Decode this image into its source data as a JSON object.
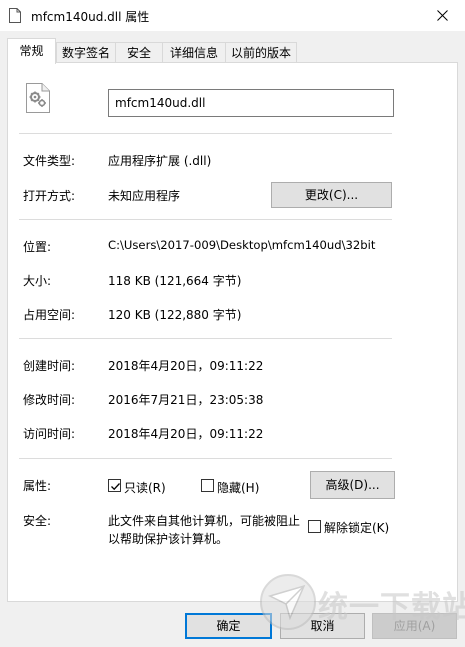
{
  "window": {
    "title": "mfcm140ud.dll 属性",
    "close_icon": "close-icon"
  },
  "tabs": [
    {
      "label": "常规",
      "active": true
    },
    {
      "label": "数字签名",
      "active": false
    },
    {
      "label": "安全",
      "active": false
    },
    {
      "label": "详细信息",
      "active": false
    },
    {
      "label": "以前的版本",
      "active": false
    }
  ],
  "general": {
    "file_icon": "gear-file-icon",
    "file_name": "mfcm140ud.dll",
    "type_label": "文件类型:",
    "type_value": "应用程序扩展 (.dll)",
    "open_with_label": "打开方式:",
    "open_with_value": "未知应用程序",
    "change_button": "更改(C)...",
    "location_label": "位置:",
    "location_value": "C:\\Users\\2017-009\\Desktop\\mfcm140ud\\32bit",
    "size_label": "大小:",
    "size_value": "118 KB (121,664 字节)",
    "size_on_disk_label": "占用空间:",
    "size_on_disk_value": "120 KB (122,880 字节)",
    "created_label": "创建时间:",
    "created_value": "2018年4月20日，09:11:22",
    "modified_label": "修改时间:",
    "modified_value": "2016年7月21日，23:05:38",
    "accessed_label": "访问时间:",
    "accessed_value": "2018年4月20日，09:11:22",
    "attributes_label": "属性:",
    "readonly_label": "只读(R)",
    "readonly_checked": true,
    "hidden_label": "隐藏(H)",
    "hidden_checked": false,
    "advanced_button": "高级(D)...",
    "security_label": "安全:",
    "security_text_line1": "此文件来自其他计算机，可能被阻止",
    "security_text_line2": "以帮助保护该计算机。",
    "unblock_label": "解除锁定(K)",
    "unblock_checked": false
  },
  "footer": {
    "ok_button": "确定",
    "cancel_button": "取消",
    "apply_button": "应用(A)"
  },
  "watermark": {
    "text": "统一下载站",
    "logo_icon": "watermark-logo-icon"
  }
}
